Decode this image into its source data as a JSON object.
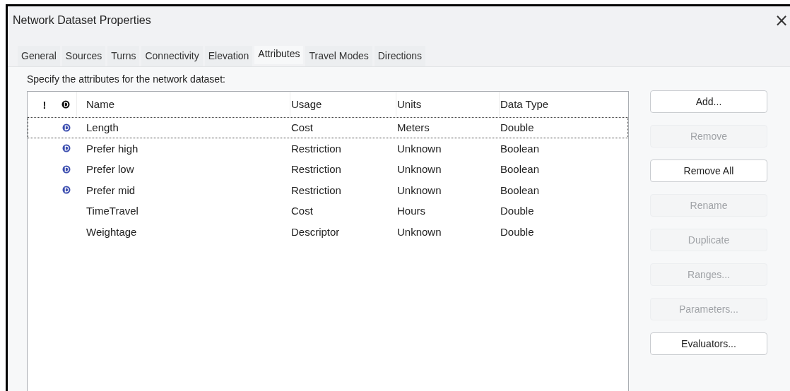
{
  "window": {
    "title": "Network Dataset Properties",
    "close": "×"
  },
  "tabs": [
    {
      "label": "General",
      "selected": false
    },
    {
      "label": "Sources",
      "selected": false
    },
    {
      "label": "Turns",
      "selected": false
    },
    {
      "label": "Connectivity",
      "selected": false
    },
    {
      "label": "Elevation",
      "selected": false
    },
    {
      "label": "Attributes",
      "selected": true
    },
    {
      "label": "Travel Modes",
      "selected": false
    },
    {
      "label": "Directions",
      "selected": false
    }
  ],
  "instruction": "Specify the attributes for the network dataset:",
  "table": {
    "warning_header": "!",
    "columns": [
      "Name",
      "Usage",
      "Units",
      "Data Type"
    ],
    "rows": [
      {
        "default": true,
        "selected": true,
        "cells": [
          "Length",
          "Cost",
          "Meters",
          "Double"
        ]
      },
      {
        "default": true,
        "selected": false,
        "cells": [
          "Prefer high",
          "Restriction",
          "Unknown",
          "Boolean"
        ]
      },
      {
        "default": true,
        "selected": false,
        "cells": [
          "Prefer low",
          "Restriction",
          "Unknown",
          "Boolean"
        ]
      },
      {
        "default": true,
        "selected": false,
        "cells": [
          "Prefer mid",
          "Restriction",
          "Unknown",
          "Boolean"
        ]
      },
      {
        "default": false,
        "selected": false,
        "cells": [
          "TimeTravel",
          "Cost",
          "Hours",
          "Double"
        ]
      },
      {
        "default": false,
        "selected": false,
        "cells": [
          "Weightage",
          "Descriptor",
          "Unknown",
          "Double"
        ]
      }
    ]
  },
  "buttons": [
    {
      "label": "Add...",
      "disabled": false
    },
    {
      "label": "Remove",
      "disabled": true
    },
    {
      "label": "Remove All",
      "disabled": false
    },
    {
      "label": "Rename",
      "disabled": true
    },
    {
      "label": "Duplicate",
      "disabled": true
    },
    {
      "label": "Ranges...",
      "disabled": true
    },
    {
      "label": "Parameters...",
      "disabled": true
    },
    {
      "label": "Evaluators...",
      "disabled": false
    }
  ]
}
